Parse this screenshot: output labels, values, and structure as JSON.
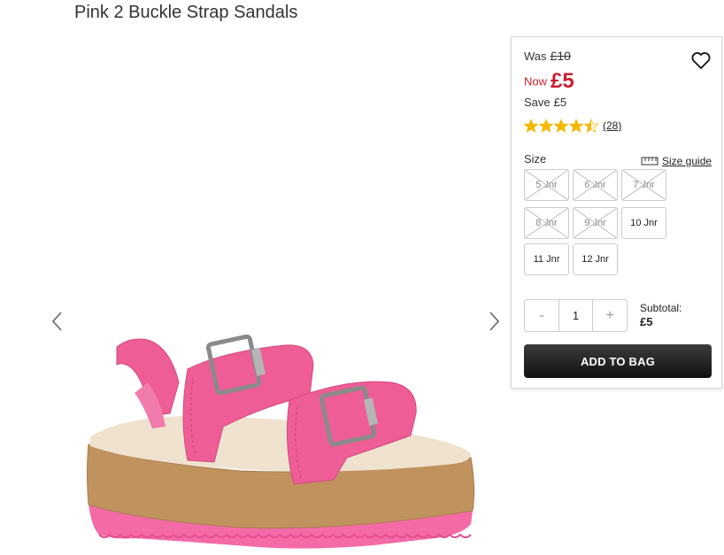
{
  "product": {
    "title": "Pink 2 Buckle Strap Sandals"
  },
  "price": {
    "was_label": "Was",
    "was_value": "£10",
    "now_label": "Now",
    "now_value": "£5",
    "save_label": "Save",
    "save_value": "£5"
  },
  "rating": {
    "stars": 4.5,
    "count": "(28)"
  },
  "size": {
    "label": "Size",
    "guide_label": "Size guide",
    "options": [
      {
        "label": "5 Jnr",
        "available": false
      },
      {
        "label": "6 Jnr",
        "available": false
      },
      {
        "label": "7 Jnr",
        "available": false
      },
      {
        "label": "8 Jnr",
        "available": false
      },
      {
        "label": "9 Jnr",
        "available": false
      },
      {
        "label": "10 Jnr",
        "available": true
      },
      {
        "label": "11 Jnr",
        "available": true
      },
      {
        "label": "12 Jnr",
        "available": true
      }
    ]
  },
  "quantity": {
    "minus": "-",
    "value": "1",
    "plus": "+"
  },
  "subtotal": {
    "label": "Subtotal:",
    "value": "£5"
  },
  "add_to_bag": "ADD TO BAG",
  "colors": {
    "sale": "#c8202f",
    "star": "#f5b800",
    "button": "#1a1a1a",
    "shoe": "#ee5d96"
  },
  "icons": {
    "prev": "chevron-left-icon",
    "next": "chevron-right-icon",
    "wishlist": "heart-icon",
    "size_guide": "ruler-icon"
  }
}
